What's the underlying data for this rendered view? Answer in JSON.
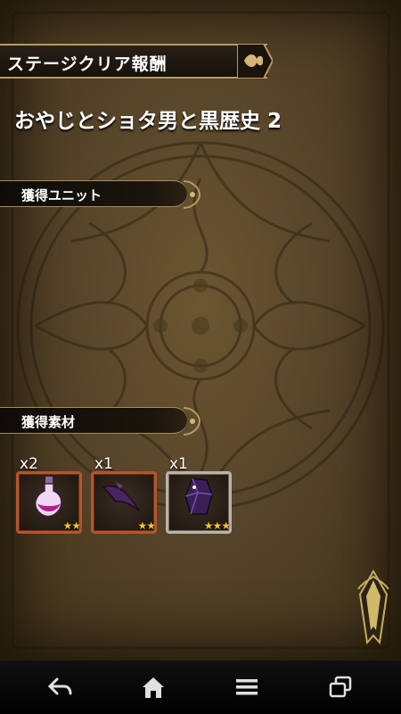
{
  "header": {
    "title": "ステージクリア報酬"
  },
  "stage": {
    "name": "おやじとショタ男と黒歴史 2"
  },
  "sections": {
    "units": {
      "label": "獲得ユニット"
    },
    "materials": {
      "label": "獲得素材"
    }
  },
  "materials": [
    {
      "count": "x2",
      "icon": "potion-icon",
      "stars": "★★",
      "rarity_color": "#b4552e"
    },
    {
      "count": "x1",
      "icon": "claw-icon",
      "stars": "★★",
      "rarity_color": "#b4552e"
    },
    {
      "count": "x1",
      "icon": "gem-icon",
      "stars": "★★★",
      "rarity_color": "#b9b3a7"
    }
  ],
  "navbar": {
    "items": [
      {
        "icon": "back-icon"
      },
      {
        "icon": "home-icon"
      },
      {
        "icon": "menu-icon"
      },
      {
        "icon": "recent-apps-icon"
      }
    ]
  }
}
